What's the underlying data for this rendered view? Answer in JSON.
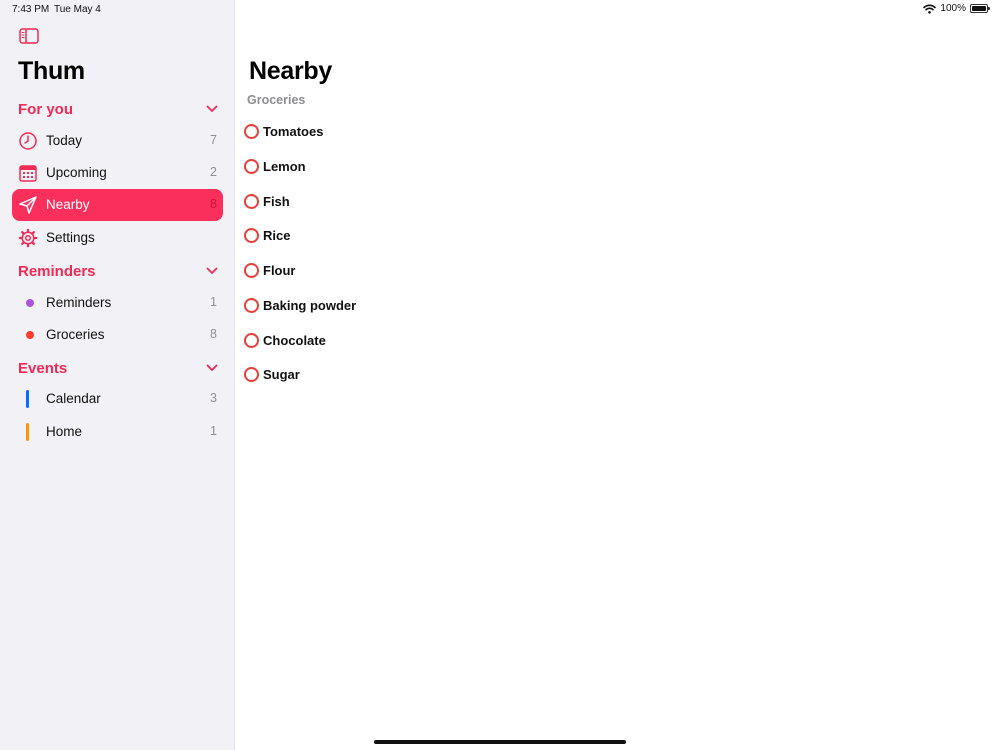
{
  "status_bar": {
    "time": "7:43 PM",
    "date": "Tue May 4",
    "battery": "100%"
  },
  "sidebar": {
    "app_title": "Thum",
    "sections": [
      {
        "label": "For you",
        "items": [
          {
            "label": "Today",
            "count": "7",
            "icon": "clock-icon"
          },
          {
            "label": "Upcoming",
            "count": "2",
            "icon": "calendar-icon"
          },
          {
            "label": "Nearby",
            "count": "8",
            "icon": "location-arrow-icon",
            "selected": true
          },
          {
            "label": "Settings",
            "count": "",
            "icon": "gear-icon"
          }
        ]
      },
      {
        "label": "Reminders",
        "items": [
          {
            "label": "Reminders",
            "count": "1",
            "color": "#af52de"
          },
          {
            "label": "Groceries",
            "count": "8",
            "color": "#ff3b30"
          }
        ]
      },
      {
        "label": "Events",
        "items": [
          {
            "label": "Calendar",
            "count": "3",
            "color": "#0a6cff"
          },
          {
            "label": "Home",
            "count": "1",
            "color": "#ff9500"
          }
        ]
      }
    ]
  },
  "main": {
    "title": "Nearby",
    "list_title": "Groceries",
    "tasks": [
      "Tomatoes",
      "Lemon",
      "Fish",
      "Rice",
      "Flour",
      "Baking powder",
      "Chocolate",
      "Sugar"
    ]
  },
  "colors": {
    "accent": "#f02a55",
    "selected_bg": "#fb2f5b",
    "task_circle": "#e63f3a",
    "sidebar_bg": "#f2f1f6"
  }
}
